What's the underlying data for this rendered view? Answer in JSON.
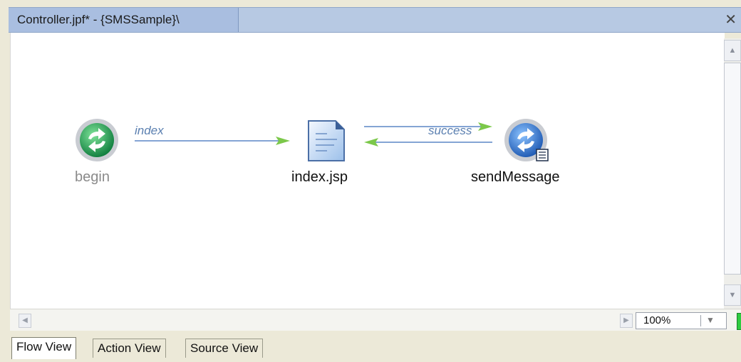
{
  "window": {
    "title": "Controller.jpf* - {SMSSample}\\"
  },
  "flow": {
    "nodes": {
      "begin": {
        "label": "begin"
      },
      "index_jsp": {
        "label": "index.jsp"
      },
      "send_message": {
        "label": "sendMessage"
      }
    },
    "edges": {
      "index": {
        "label": "index"
      },
      "success": {
        "label": "success"
      }
    }
  },
  "zoom": {
    "value": "100%"
  },
  "tabs": [
    {
      "label": "Flow View",
      "active": true
    },
    {
      "label": "Action View",
      "active": false
    },
    {
      "label": "Source View",
      "active": false
    }
  ],
  "colors": {
    "titlebar": "#b7c9e3",
    "edge": "#5b86c6",
    "arrowhead": "#7cc84a",
    "status": "#2ecc40"
  }
}
